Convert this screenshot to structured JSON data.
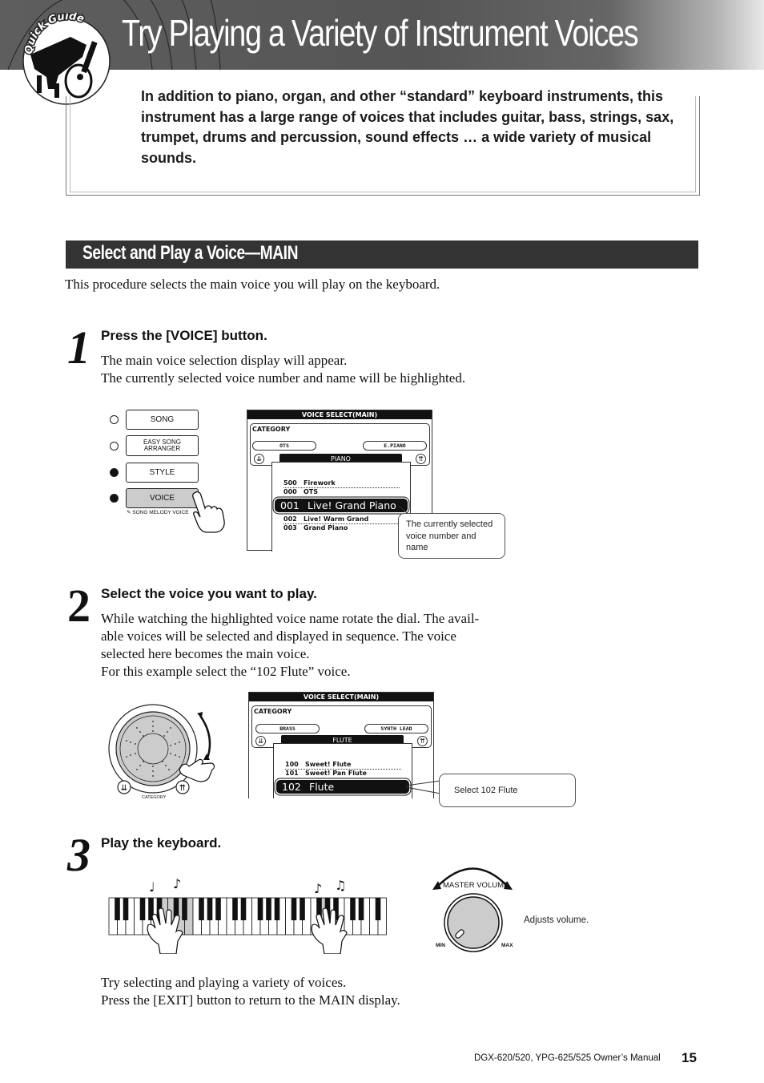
{
  "header": {
    "badge_label": "Quick Guide",
    "title": "Try Playing a Variety of Instrument Voices"
  },
  "intro": {
    "text": "In addition to piano, organ, and other “standard” keyboard instruments, this instrument has a large range of voices that includes guitar, bass, strings, sax, trumpet, drums and percussion, sound effects … a wide variety of musical sounds."
  },
  "section": {
    "title": "Select and Play a Voice—MAIN",
    "description": "This procedure selects the main voice you will play on the keyboard."
  },
  "steps": [
    {
      "number": "1",
      "heading": "Press the [VOICE] button.",
      "body_lines": [
        "The main voice selection display will appear.",
        "The currently selected voice number and name will be highlighted."
      ]
    },
    {
      "number": "2",
      "heading": "Select the voice you want to play.",
      "body_lines": [
        "While watching the highlighted voice name rotate the dial. The avail-",
        "able voices will be selected and displayed in sequence. The voice",
        "selected here becomes the main voice.",
        "For this example select the “102 Flute” voice."
      ]
    },
    {
      "number": "3",
      "heading": "Play the keyboard."
    }
  ],
  "panel_buttons": [
    {
      "label": "SONG",
      "led": "off"
    },
    {
      "label": "EASY SONG ARRANGER",
      "led": "off"
    },
    {
      "label": "STYLE",
      "led": "on"
    },
    {
      "label": "VOICE",
      "led": "on",
      "pressed": true
    }
  ],
  "panel_sublabel": "SONG MELODY VOICE",
  "display1": {
    "header": "VOICE SELECT(MAIN)",
    "category_label": "CATEGORY",
    "prev_category": "OTS",
    "next_category": "E.PIANO",
    "current_category": "PIANO",
    "voices_before": [
      {
        "num": "500",
        "name": "Firework"
      },
      {
        "num": "000",
        "name": "OTS"
      }
    ],
    "selected": {
      "num": "001",
      "name": "Live! Grand Piano"
    },
    "voices_after": [
      {
        "num": "002",
        "name": "Live! Warm Grand"
      },
      {
        "num": "003",
        "name": "Grand Piano"
      }
    ],
    "callout": "The currently selected voice number and name"
  },
  "dial": {
    "category_label": "CATEGORY"
  },
  "display2": {
    "header": "VOICE SELECT(MAIN)",
    "category_label": "CATEGORY",
    "prev_category": "BRASS",
    "next_category": "SYNTH LEAD",
    "current_category": "FLUTE",
    "voices_before": [
      {
        "num": "100",
        "name": "Sweet! Flute"
      },
      {
        "num": "101",
        "name": "Sweet! Pan Flute"
      }
    ],
    "selected": {
      "num": "102",
      "name": "Flute"
    },
    "callout": "Select 102 Flute"
  },
  "volume": {
    "label": "MASTER VOLUME",
    "min_label": "MIN",
    "max_label": "MAX",
    "caption": "Adjusts volume."
  },
  "closing": {
    "lines": [
      "Try selecting and playing a variety of voices.",
      "Press the [EXIT] button to return to the MAIN display."
    ]
  },
  "footer": {
    "manual": "DGX-620/520, YPG-625/525  Owner’s Manual",
    "page": "15"
  }
}
